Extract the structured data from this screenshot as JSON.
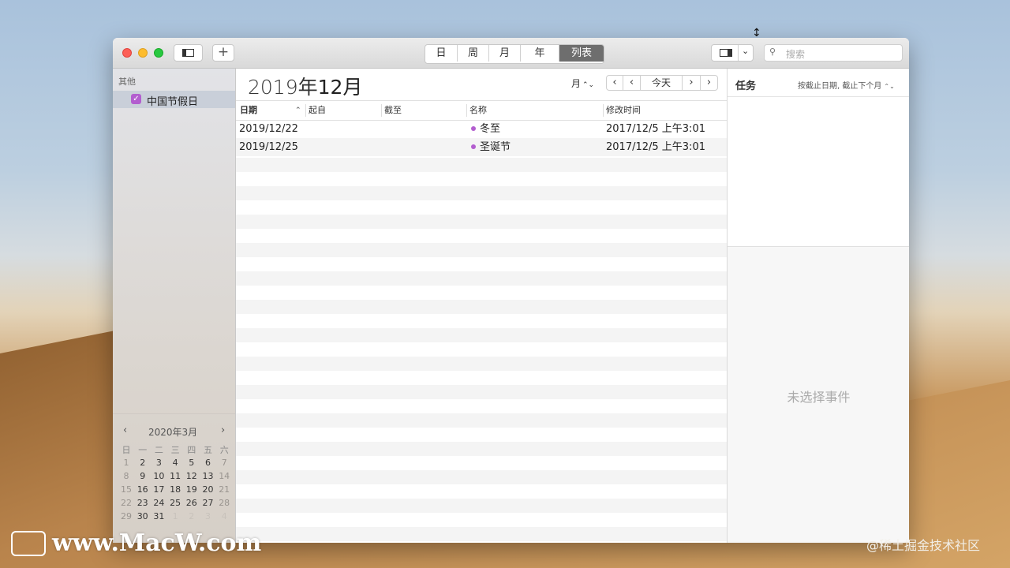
{
  "toolbar": {
    "views": [
      "日",
      "周",
      "月",
      "年",
      "列表"
    ],
    "active_view": "列表",
    "search_placeholder": "搜索"
  },
  "sidebar": {
    "section": "其他",
    "calendars": [
      {
        "label": "中国节假日",
        "checked": true,
        "color": "#b35ecf"
      }
    ],
    "mini_calendar": {
      "title": "2020年3月",
      "weekdays": [
        "日",
        "一",
        "二",
        "三",
        "四",
        "五",
        "六"
      ],
      "weeks": [
        [
          "1",
          "2",
          "3",
          "4",
          "5",
          "6",
          "7"
        ],
        [
          "8",
          "9",
          "10",
          "11",
          "12",
          "13",
          "14"
        ],
        [
          "15",
          "16",
          "17",
          "18",
          "19",
          "20",
          "21"
        ],
        [
          "22",
          "23",
          "24",
          "25",
          "26",
          "27",
          "28"
        ],
        [
          "29",
          "30",
          "31",
          "1",
          "2",
          "3",
          "4"
        ]
      ]
    }
  },
  "main": {
    "title_year": "2019年",
    "title_month": "12月",
    "scope": "月",
    "today_label": "今天",
    "columns": [
      "日期",
      "起自",
      "截至",
      "名称",
      "修改时间"
    ],
    "rows": [
      {
        "date": "2019/12/22",
        "from": "",
        "to": "",
        "name": "冬至",
        "modified": "2017/12/5 上午3:01"
      },
      {
        "date": "2019/12/25",
        "from": "",
        "to": "",
        "name": "圣诞节",
        "modified": "2017/12/5 上午3:01"
      }
    ]
  },
  "tasks": {
    "title": "任务",
    "filter": "按截止日期, 截止下个月",
    "empty": "未选择事件"
  },
  "watermarks": {
    "left": "www.MacW.com",
    "right": "@稀土掘金技术社区"
  }
}
